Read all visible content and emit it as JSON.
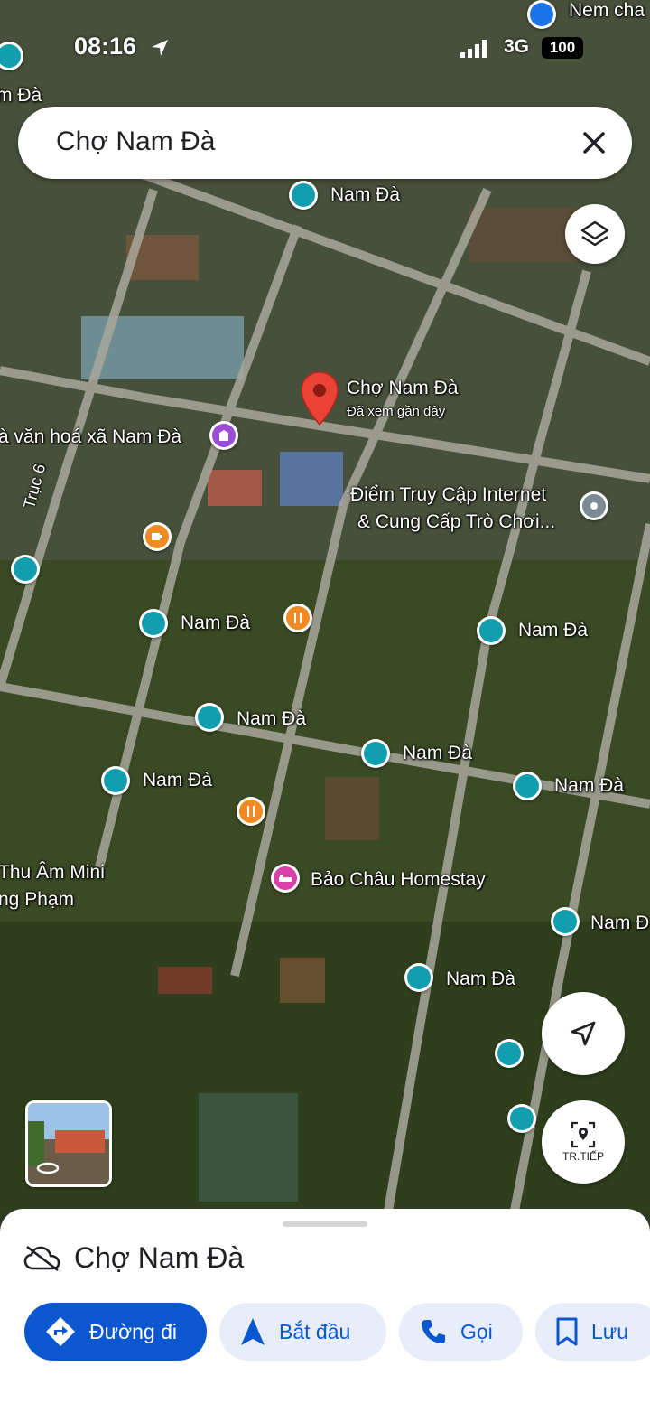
{
  "status_bar": {
    "time": "08:16",
    "network": "3G",
    "battery": "100"
  },
  "search": {
    "query": "Chợ Nam Đà"
  },
  "map": {
    "selected_place": {
      "name": "Chợ Nam Đà",
      "subtitle": "Đã xem gần đây"
    },
    "labels": {
      "nem_cha": "Nem cha",
      "nam_da_edge": "m Đà",
      "nam_da_top": "Nam Đà",
      "van_hoa": "à văn hoá xã Nam Đà",
      "internet_line1": "Điểm Truy Cập Internet",
      "internet_line2": "& Cung Cấp Trò Chơi...",
      "truc6": "Trục 6",
      "nam_da_1": "Nam Đà",
      "nam_da_2": "Nam Đà",
      "nam_da_3": "Nam Đà",
      "nam_da_4": "Nam Đà",
      "nam_da_5": "Nam Đà",
      "nam_da_6": "Nam Đà",
      "nam_da_7": "Nam Đà",
      "nam_edge": "Nam Đ",
      "thu_am_line1": "Thu Âm Mini",
      "thu_am_line2": "ng Phạm",
      "homestay": "Bảo Châu Homestay"
    },
    "next_button_label": "TR.TIẾP"
  },
  "bottom_sheet": {
    "title": "Chợ Nam Đà",
    "actions": [
      {
        "label": "Đường đi"
      },
      {
        "label": "Bắt đầu"
      },
      {
        "label": "Gọi"
      },
      {
        "label": "Lưu"
      }
    ]
  },
  "colors": {
    "accent": "#0b57d0",
    "marker_red": "#ea4335",
    "poi_teal": "#129eaf",
    "poi_orange": "#f08a24"
  }
}
